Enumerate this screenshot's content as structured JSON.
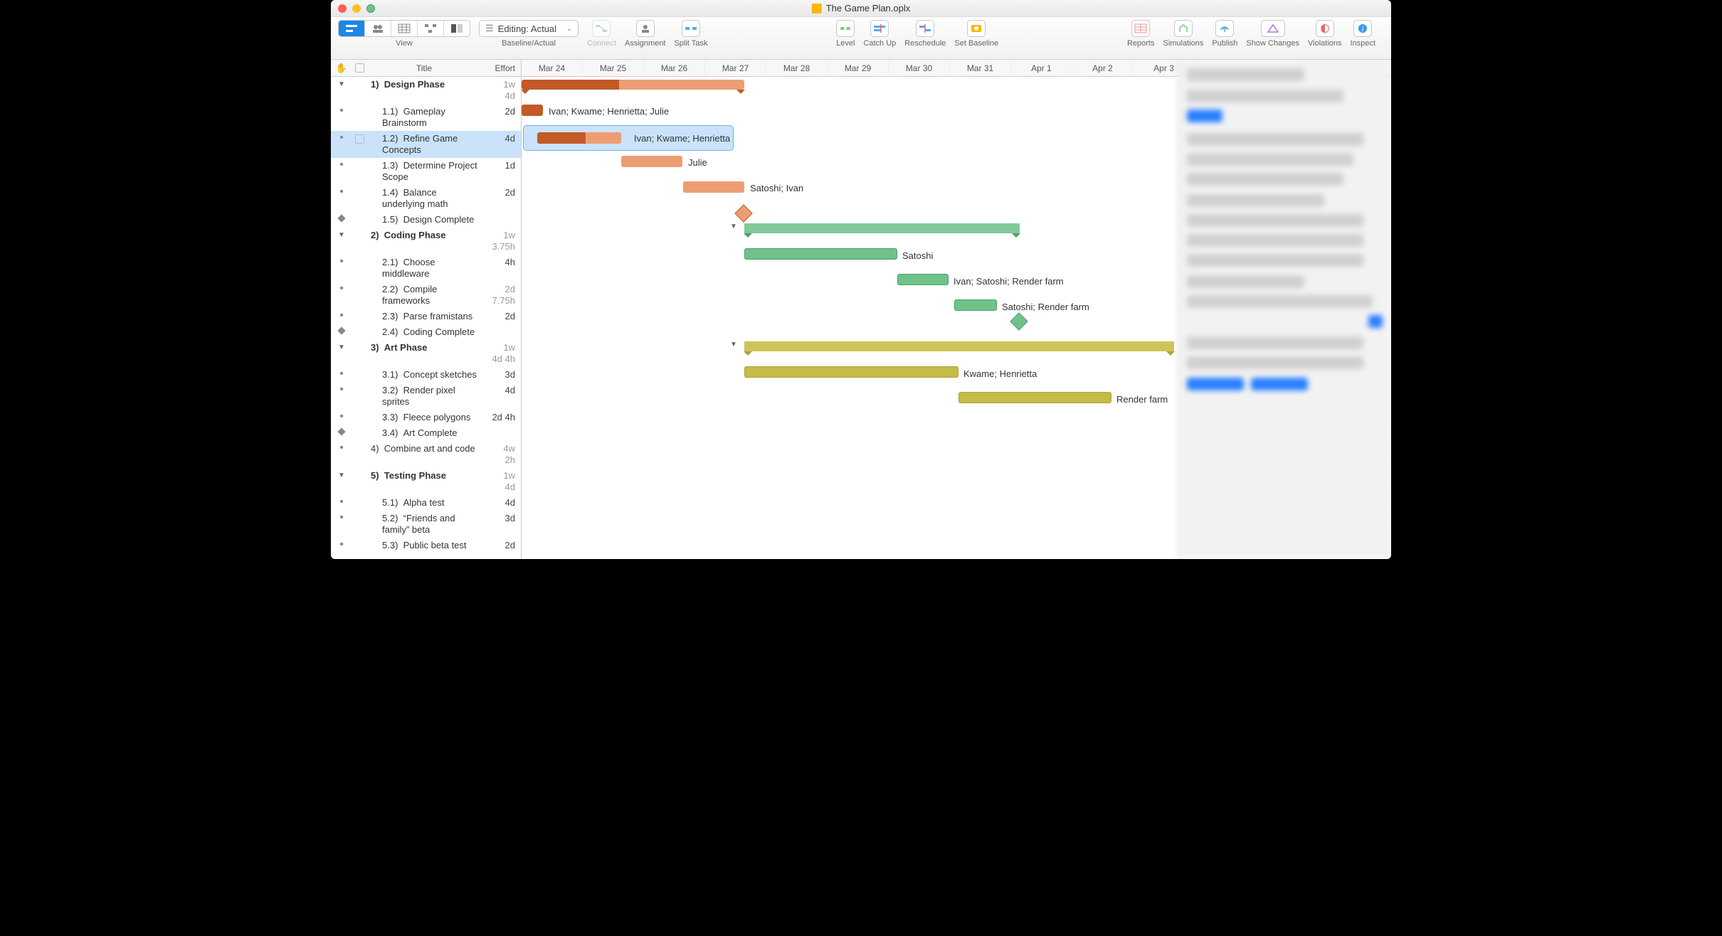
{
  "window": {
    "title": "The Game Plan.oplx"
  },
  "toolbar": {
    "view_label": "View",
    "baseline_dropdown": "Editing: Actual",
    "baseline_label": "Baseline/Actual",
    "connect_label": "Connect",
    "assignment_label": "Assignment",
    "split_label": "Split Task",
    "level_label": "Level",
    "catchup_label": "Catch Up",
    "reschedule_label": "Reschedule",
    "setbaseline_label": "Set Baseline",
    "reports_label": "Reports",
    "simulations_label": "Simulations",
    "publish_label": "Publish",
    "showchanges_label": "Show Changes",
    "violations_label": "Violations",
    "inspect_label": "Inspect"
  },
  "columns": {
    "title": "Title",
    "effort": "Effort"
  },
  "dates": [
    "Mar 24",
    "Mar 25",
    "Mar 26",
    "Mar 27",
    "Mar 28",
    "Mar 29",
    "Mar 30",
    "Mar 31",
    "Apr 1",
    "Apr 2",
    "Apr 3"
  ],
  "tasks": [
    {
      "id": "1",
      "num": "1)",
      "title": "Design Phase",
      "effort": "1w",
      "effort2": "4d",
      "type": "phase",
      "indent": 0
    },
    {
      "id": "1.1",
      "num": "1.1)",
      "title": "Gameplay Brainstorm",
      "effort": "2d",
      "type": "task",
      "indent": 1,
      "resources": "Ivan; Kwame; Henrietta; Julie"
    },
    {
      "id": "1.2",
      "num": "1.2)",
      "title": "Refine Game Concepts",
      "effort": "4d",
      "type": "task",
      "indent": 1,
      "selected": true,
      "resources": "Ivan; Kwame; Henrietta"
    },
    {
      "id": "1.3",
      "num": "1.3)",
      "title": "Determine Project Scope",
      "effort": "1d",
      "type": "task",
      "indent": 1,
      "resources": "Julie"
    },
    {
      "id": "1.4",
      "num": "1.4)",
      "title": "Balance underlying math",
      "effort": "2d",
      "type": "task",
      "indent": 1,
      "resources": "Satoshi; Ivan"
    },
    {
      "id": "1.5",
      "num": "1.5)",
      "title": "Design Complete",
      "effort": "",
      "type": "milestone",
      "indent": 1
    },
    {
      "id": "2",
      "num": "2)",
      "title": "Coding Phase",
      "effort": "1w",
      "effort2": "3.75h",
      "type": "phase",
      "indent": 0
    },
    {
      "id": "2.1",
      "num": "2.1)",
      "title": "Choose middleware",
      "effort": "4h",
      "type": "task",
      "indent": 1,
      "resources": "Satoshi"
    },
    {
      "id": "2.2",
      "num": "2.2)",
      "title": "Compile frameworks",
      "effort": "2d",
      "effort2": "7.75h",
      "type": "task",
      "indent": 1,
      "resources": "Ivan; Satoshi; Render farm"
    },
    {
      "id": "2.3",
      "num": "2.3)",
      "title": "Parse framistans",
      "effort": "2d",
      "type": "task",
      "indent": 1,
      "resources": "Satoshi; Render farm"
    },
    {
      "id": "2.4",
      "num": "2.4)",
      "title": "Coding Complete",
      "effort": "",
      "type": "milestone",
      "indent": 1
    },
    {
      "id": "3",
      "num": "3)",
      "title": "Art Phase",
      "effort": "1w",
      "effort2": "4d 4h",
      "type": "phase",
      "indent": 0
    },
    {
      "id": "3.1",
      "num": "3.1)",
      "title": "Concept sketches",
      "effort": "3d",
      "type": "task",
      "indent": 1,
      "resources": "Kwame; Henrietta"
    },
    {
      "id": "3.2",
      "num": "3.2)",
      "title": "Render pixel sprites",
      "effort": "4d",
      "type": "task",
      "indent": 1,
      "resources": "Render farm"
    },
    {
      "id": "3.3",
      "num": "3.3)",
      "title": "Fleece polygons",
      "effort": "2d 4h",
      "type": "task",
      "indent": 1
    },
    {
      "id": "3.4",
      "num": "3.4)",
      "title": "Art Complete",
      "effort": "",
      "type": "milestone",
      "indent": 1
    },
    {
      "id": "4",
      "num": "4)",
      "title": "Combine art and code",
      "effort": "4w",
      "effort2": "2h",
      "type": "task",
      "indent": 0
    },
    {
      "id": "5",
      "num": "5)",
      "title": "Testing Phase",
      "effort": "1w",
      "effort2": "4d",
      "type": "phase",
      "indent": 0
    },
    {
      "id": "5.1",
      "num": "5.1)",
      "title": "Alpha test",
      "effort": "4d",
      "type": "task",
      "indent": 1
    },
    {
      "id": "5.2",
      "num": "5.2)",
      "title": "“Friends and family” beta",
      "effort": "3d",
      "type": "task",
      "indent": 1
    },
    {
      "id": "5.3",
      "num": "5.3)",
      "title": "Public beta test",
      "effort": "2d",
      "type": "task",
      "indent": 1
    }
  ]
}
